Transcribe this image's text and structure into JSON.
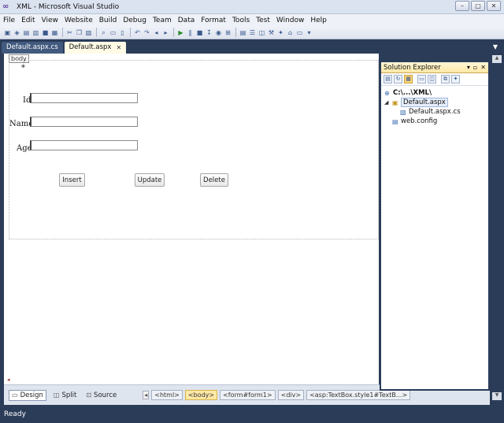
{
  "window": {
    "title": "XML - Microsoft Visual Studio",
    "controls": [
      "–",
      "▢",
      "✕"
    ]
  },
  "menu": [
    "File",
    "Edit",
    "View",
    "Website",
    "Build",
    "Debug",
    "Team",
    "Data",
    "Format",
    "Tools",
    "Test",
    "Window",
    "Help"
  ],
  "tabs": [
    {
      "label": "Default.aspx.cs",
      "active": false
    },
    {
      "label": "Default.aspx",
      "active": true,
      "close": "✕"
    }
  ],
  "tab_overflow": "▼",
  "designer": {
    "body_tag": "body",
    "asterisk": "*",
    "fields": [
      {
        "label": "Id",
        "value": ""
      },
      {
        "label": "Name",
        "value": ""
      },
      {
        "label": "Age",
        "value": ""
      }
    ],
    "buttons": {
      "insert": "Insert",
      "update": "Update",
      "delete": "Delete"
    }
  },
  "view_tabs": [
    {
      "label": "Design",
      "active": true
    },
    {
      "label": "Split",
      "active": false
    },
    {
      "label": "Source",
      "active": false
    }
  ],
  "breadcrumbs": [
    "<html>",
    "<body>",
    "<form#form1>",
    "<div>",
    "<asp:TextBox.style1#TextB...>"
  ],
  "breadcrumb_active_index": 1,
  "solution_explorer": {
    "title": "Solution Explorer",
    "header_controls": [
      "▾",
      "▫",
      "✕"
    ],
    "tree": {
      "root": "C:\\...\\XML\\",
      "file": "Default.aspx",
      "code_behind": "Default.aspx.cs",
      "config": "web.config"
    }
  },
  "status": "Ready",
  "colors": {
    "chrome": "#2b3c59",
    "accent": "#ffe8a6"
  }
}
